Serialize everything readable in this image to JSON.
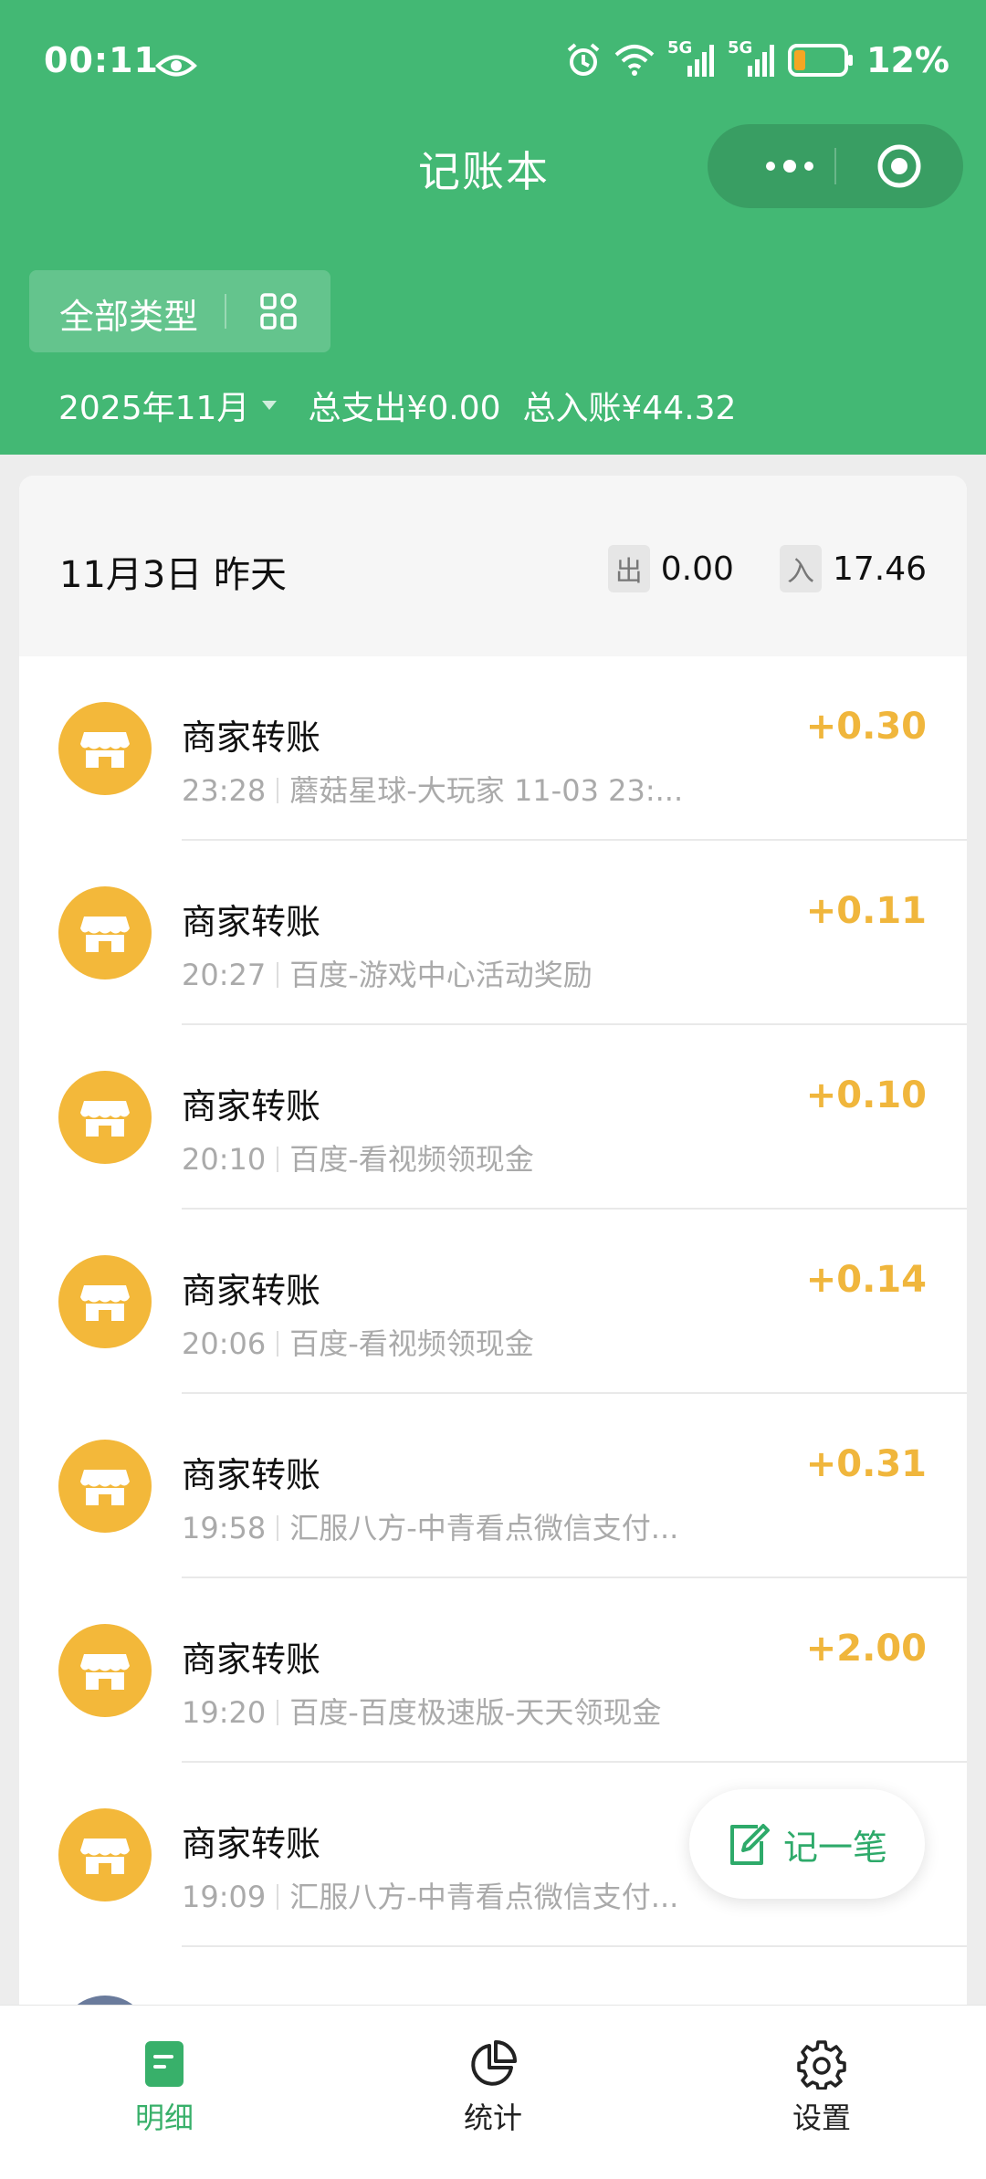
{
  "status_bar": {
    "time": "00:11",
    "battery_percent": "12%",
    "network_1": "5G",
    "network_2": "5G",
    "icons": [
      "eye-icon",
      "alarm-icon",
      "wifi-icon",
      "signal-icon",
      "signal-icon",
      "battery-icon"
    ]
  },
  "header": {
    "title": "记账本",
    "filter_label": "全部类型",
    "month": "2025年11月",
    "total_expense": "总支出¥0.00",
    "total_income": "总入账¥44.32"
  },
  "day": {
    "title": "11月3日 昨天",
    "out_tag": "出",
    "out_value": "0.00",
    "in_tag": "入",
    "in_value": "17.46"
  },
  "transactions": [
    {
      "name": "商家转账",
      "time": "23:28",
      "desc": "蘑菇星球-大玩家 11-03 23:...",
      "amount": "+0.30"
    },
    {
      "name": "商家转账",
      "time": "20:27",
      "desc": "百度-游戏中心活动奖励",
      "amount": "+0.11"
    },
    {
      "name": "商家转账",
      "time": "20:10",
      "desc": "百度-看视频领现金",
      "amount": "+0.10"
    },
    {
      "name": "商家转账",
      "time": "20:06",
      "desc": "百度-看视频领现金",
      "amount": "+0.14"
    },
    {
      "name": "商家转账",
      "time": "19:58",
      "desc": "汇服八方-中青看点微信支付...",
      "amount": "+0.31"
    },
    {
      "name": "商家转账",
      "time": "19:20",
      "desc": "百度-百度极速版-天天领现金",
      "amount": "+2.00"
    },
    {
      "name": "商家转账",
      "time": "19:09",
      "desc": "汇服八方-中青看点微信支付...",
      "amount": ""
    }
  ],
  "fab_label": "记一笔",
  "tabs": [
    {
      "label": "明细",
      "icon": "detail-icon",
      "active": true
    },
    {
      "label": "统计",
      "icon": "pie-chart-icon",
      "active": false
    },
    {
      "label": "设置",
      "icon": "gear-icon",
      "active": false
    }
  ],
  "colors": {
    "header_green": "#43b874",
    "amount_gold": "#f0b63c",
    "avatar_gold": "#f3b83a",
    "active_tab_green": "#38b06a"
  }
}
